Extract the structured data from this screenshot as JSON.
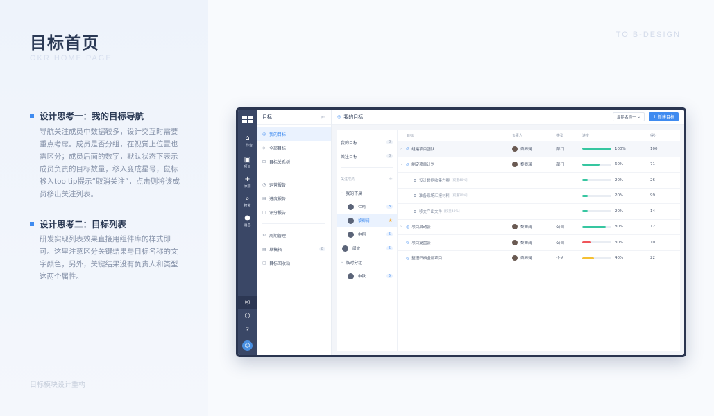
{
  "page": {
    "title": "目标首页",
    "subtitle": "OKR HOME PAGE",
    "brand": "TO B-DESIGN",
    "footer": "目标模块设计重构"
  },
  "sections": [
    {
      "heading": "设计思考一：我的目标导航",
      "body": "导航关注成员中数据较多，设计交互时需要重点考虑。成员是否分组，在视觉上位置也需区分；成员后面的数字，默认状态下表示成员负责的目标数量，移入变成星号，鼠标移入tooltip提示“取消关注”，点击则将该成员移出关注列表。"
    },
    {
      "heading": "设计思考二：目标列表",
      "body": "研发实现列表效果直接用组件库的样式即可。这里注意区分关键结果与目标名称的文字颜色，另外，关键结果没有负责人和类型这两个属性。"
    }
  ],
  "rail": {
    "items": [
      {
        "icon": "home-icon",
        "glyph": "⌂",
        "label": "工作台"
      },
      {
        "icon": "project-icon",
        "glyph": "▣",
        "label": "项目"
      },
      {
        "icon": "add-icon",
        "glyph": "+",
        "label": "添加"
      },
      {
        "icon": "search-icon",
        "glyph": "⌕",
        "label": "搜索"
      },
      {
        "icon": "message-icon",
        "glyph": "●",
        "label": "消息"
      }
    ],
    "bottom": [
      {
        "icon": "target-icon",
        "glyph": "◎"
      },
      {
        "icon": "cube-icon",
        "glyph": "⬡"
      },
      {
        "icon": "help-icon",
        "glyph": "?"
      }
    ]
  },
  "nav": {
    "title": "目标",
    "items": [
      {
        "label": "我的目标",
        "glyph": "◎"
      },
      {
        "label": "全部目标",
        "glyph": "◇"
      },
      {
        "label": "目标关系树",
        "glyph": "⊞"
      }
    ],
    "reports": [
      {
        "label": "运营报告",
        "glyph": "◔"
      },
      {
        "label": "进度报告",
        "glyph": "▤"
      },
      {
        "label": "评分报告",
        "glyph": "▢"
      }
    ],
    "others": [
      {
        "label": "周期管理",
        "glyph": "↻"
      },
      {
        "label": "草稿箱",
        "glyph": "▤",
        "count": "8"
      },
      {
        "label": "目标回收站",
        "glyph": "▢"
      }
    ]
  },
  "header": {
    "title": "我的目标",
    "period_placeholder": "周期名称一",
    "new_button": "新建目标"
  },
  "members": {
    "mine": {
      "label": "我的目标",
      "count": "8"
    },
    "followed": {
      "label": "关注目标",
      "count": "8"
    },
    "group_label": "关注成员",
    "sub1": "我的下属",
    "people1": [
      {
        "name": "仁飚",
        "count": "8"
      },
      {
        "name": "黎卿澜",
        "star": "★"
      },
      {
        "name": "申翔",
        "count": "5"
      }
    ],
    "loose": {
      "name": "阚波",
      "count": "5"
    },
    "sub2": "临时分组",
    "people2": [
      {
        "name": "申铁",
        "count": "5"
      }
    ]
  },
  "table": {
    "headers": [
      "目标",
      "负责人",
      "类型",
      "进度",
      "得分"
    ],
    "rows": [
      {
        "kind": "obj",
        "name": "组建项目团队",
        "owner": "黎卿澜",
        "type": "部门",
        "progress": 100,
        "progress_label": "100%",
        "color": "#36c6a0",
        "score": "100",
        "chev": "›"
      },
      {
        "kind": "obj",
        "name": "制定项目计划",
        "owner": "黎卿澜",
        "type": "部门",
        "progress": 60,
        "progress_label": "60%",
        "color": "#36c6a0",
        "score": "71",
        "chev": "⌄"
      },
      {
        "kind": "kr",
        "name": "设计数据收集方案",
        "weight": "[权重40%]",
        "progress": 20,
        "progress_label": "20%",
        "color": "#36c6a0",
        "score": "26"
      },
      {
        "kind": "kr",
        "name": "准备现场汇报材料",
        "weight": "[权重20%]",
        "progress": 20,
        "progress_label": "20%",
        "color": "#36c6a0",
        "score": "99"
      },
      {
        "kind": "kr",
        "name": "移交产出文件",
        "weight": "[权重40%]",
        "progress": 20,
        "progress_label": "20%",
        "color": "#36c6a0",
        "score": "14"
      },
      {
        "kind": "obj",
        "name": "项目启动会",
        "owner": "黎卿澜",
        "type": "公司",
        "progress": 80,
        "progress_label": "80%",
        "color": "#36c6a0",
        "score": "12",
        "chev": "›"
      },
      {
        "kind": "obj",
        "name": "项目复盘会",
        "owner": "黎卿澜",
        "type": "公司",
        "progress": 30,
        "progress_label": "30%",
        "color": "#f0555a",
        "score": "10"
      },
      {
        "kind": "obj",
        "name": "整理归档全部项目",
        "owner": "黎卿澜",
        "type": "个人",
        "progress": 40,
        "progress_label": "40%",
        "color": "#f5c033",
        "score": "22"
      }
    ]
  }
}
